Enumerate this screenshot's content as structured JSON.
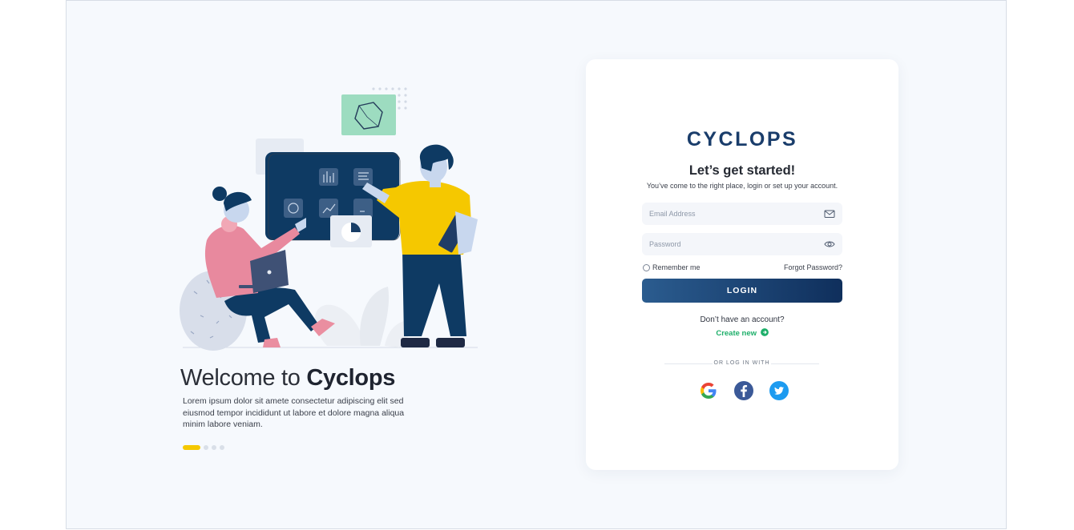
{
  "welcome": {
    "title_prefix": "Welcome to",
    "title_brand": "Cyclops",
    "description": "Lorem ipsum dolor sit amete consectetur adipiscing elit sed eiusmod tempor incididunt ut labore et dolore magna aliqua minim labore veniam."
  },
  "carousel": {
    "total": 4,
    "active": 1
  },
  "card": {
    "logo": "CYCLOPS",
    "headline": "Let’s get started!",
    "subline": "You’ve come to the right place, login or set up your account.",
    "email_placeholder": "Email Address",
    "password_placeholder": "Password",
    "remember_label": "Remember me",
    "forgot_label": "Forgot Password?",
    "login_label": "LOGIN",
    "no_account": "Don’t have an account?",
    "create_label": "Create new",
    "or_login_with": "OR LOG IN WITH"
  },
  "icons": {
    "email": "mail-icon",
    "password": "eye-icon",
    "create": "arrow-right-circle-icon",
    "google": "google-icon",
    "facebook": "facebook-icon",
    "twitter": "twitter-icon"
  },
  "colors": {
    "brand": "#1a3d6b",
    "accent_green": "#1eaf6a",
    "carousel_active": "#f5c800",
    "button_gradient_start": "#2b5c8f",
    "button_gradient_end": "#0f2f5c"
  }
}
